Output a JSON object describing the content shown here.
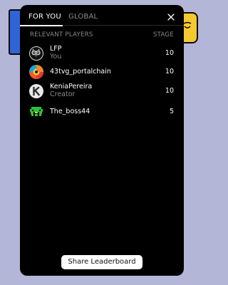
{
  "tabs": [
    {
      "label": "FOR YOU",
      "active": true
    },
    {
      "label": "GLOBAL",
      "active": false
    }
  ],
  "columns": {
    "players": "RELEVANT PLAYERS",
    "stage": "STAGE"
  },
  "players": [
    {
      "name": "LFP",
      "subtitle": "You",
      "stage": "10",
      "avatar": "owl-avatar-icon"
    },
    {
      "name": "43tvg_portalchain",
      "subtitle": "",
      "stage": "10",
      "avatar": "colorful-pattern-avatar-icon"
    },
    {
      "name": "KeniaPereira",
      "subtitle": "Creator",
      "stage": "10",
      "avatar": "letter-k-avatar-icon"
    },
    {
      "name": "The_boss44",
      "subtitle": "",
      "stage": "5",
      "avatar": "pixel-invader-avatar-icon"
    }
  ],
  "share_button": "Share Leaderboard",
  "colors": {
    "panel": "#000000",
    "backdrop": "#b3b6d6",
    "muted_text": "#8a8a8a",
    "accent_blue": "#2f64d6",
    "accent_yellow": "#f4c930"
  }
}
